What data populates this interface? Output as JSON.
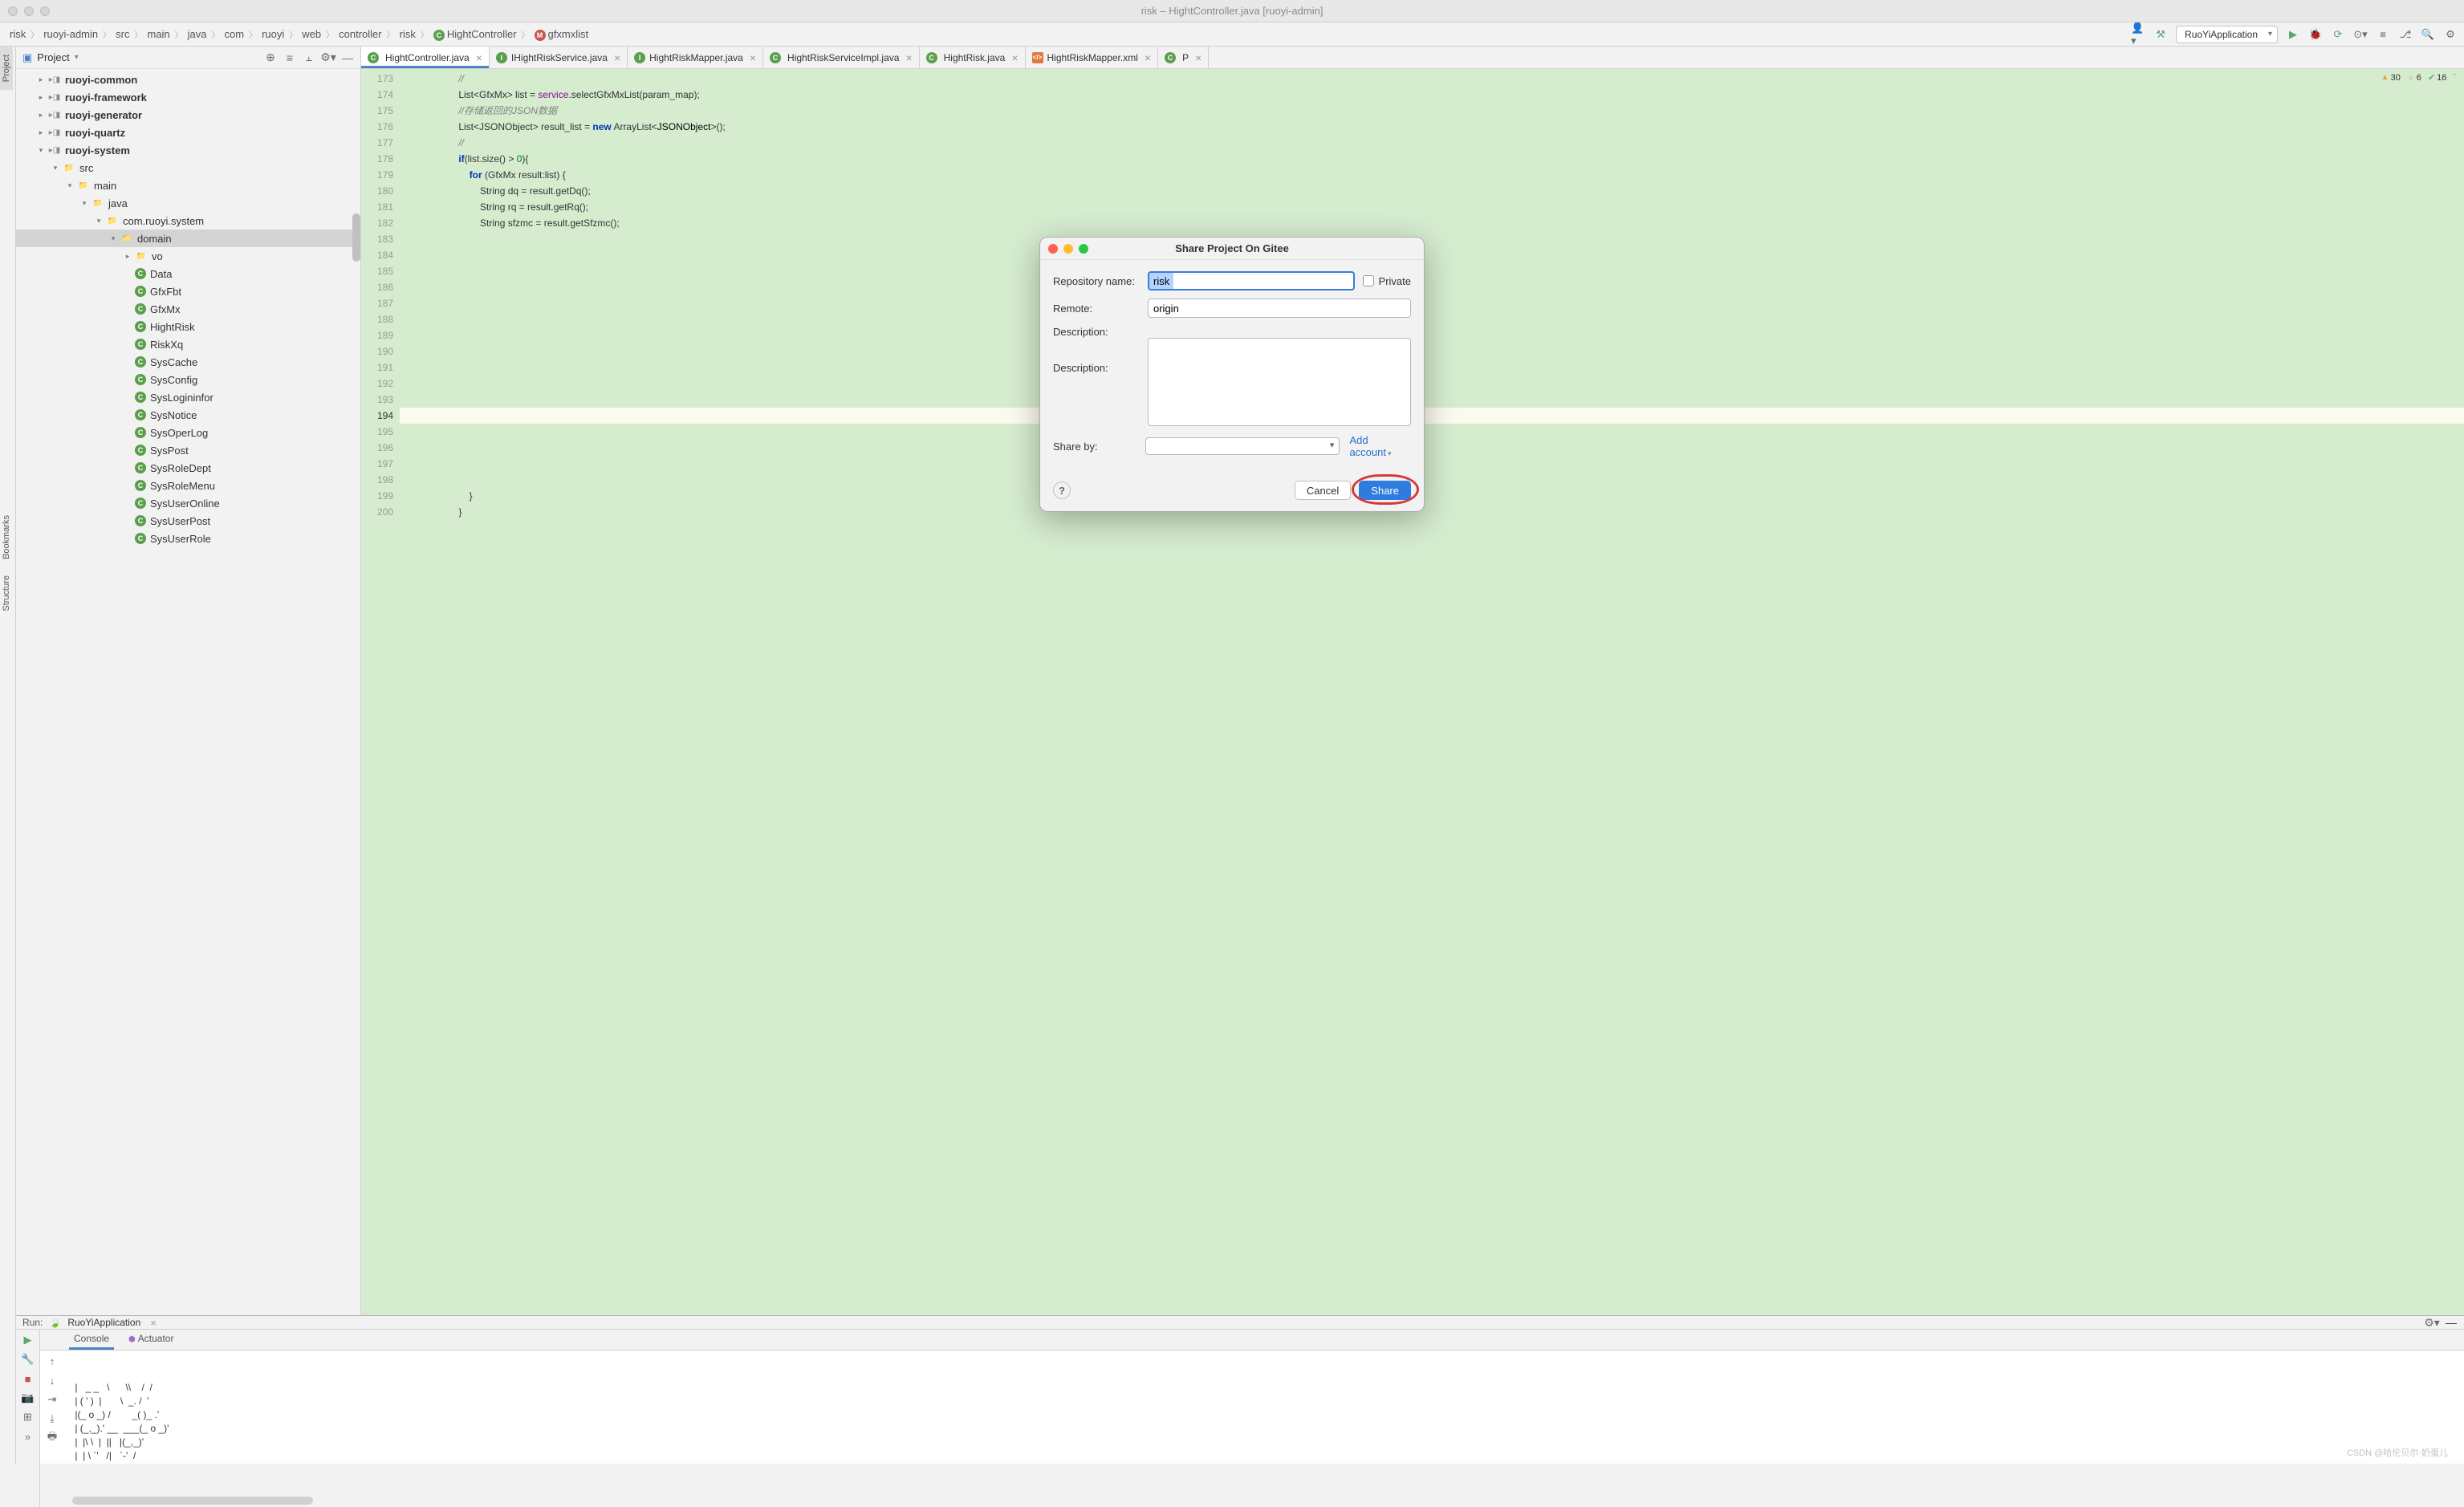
{
  "window": {
    "title": "risk – HightController.java [ruoyi-admin]"
  },
  "breadcrumbs": [
    {
      "label": "risk"
    },
    {
      "label": "ruoyi-admin"
    },
    {
      "label": "src"
    },
    {
      "label": "main"
    },
    {
      "label": "java"
    },
    {
      "label": "com"
    },
    {
      "label": "ruoyi"
    },
    {
      "label": "web"
    },
    {
      "label": "controller"
    },
    {
      "label": "risk"
    },
    {
      "label": "HightController",
      "icon": "c"
    },
    {
      "label": "gfxmxlist",
      "icon": "m"
    }
  ],
  "runConfig": "RuoYiApplication",
  "sidebar": {
    "title": "Project",
    "tree": [
      {
        "depth": 1,
        "arrow": "▸",
        "type": "module",
        "label": "ruoyi-common",
        "bold": true
      },
      {
        "depth": 1,
        "arrow": "▸",
        "type": "module",
        "label": "ruoyi-framework",
        "bold": true
      },
      {
        "depth": 1,
        "arrow": "▸",
        "type": "module",
        "label": "ruoyi-generator",
        "bold": true
      },
      {
        "depth": 1,
        "arrow": "▸",
        "type": "module",
        "label": "ruoyi-quartz",
        "bold": true
      },
      {
        "depth": 1,
        "arrow": "▾",
        "type": "module",
        "label": "ruoyi-system",
        "bold": true
      },
      {
        "depth": 2,
        "arrow": "▾",
        "type": "folder",
        "label": "src"
      },
      {
        "depth": 3,
        "arrow": "▾",
        "type": "folder",
        "label": "main"
      },
      {
        "depth": 4,
        "arrow": "▾",
        "type": "java-folder",
        "label": "java"
      },
      {
        "depth": 5,
        "arrow": "▾",
        "type": "pkg",
        "label": "com.ruoyi.system"
      },
      {
        "depth": 6,
        "arrow": "▾",
        "type": "pkg",
        "label": "domain",
        "selected": true
      },
      {
        "depth": 7,
        "arrow": "▸",
        "type": "pkg",
        "label": "vo"
      },
      {
        "depth": 7,
        "arrow": "",
        "type": "class",
        "label": "Data"
      },
      {
        "depth": 7,
        "arrow": "",
        "type": "class",
        "label": "GfxFbt"
      },
      {
        "depth": 7,
        "arrow": "",
        "type": "class",
        "label": "GfxMx"
      },
      {
        "depth": 7,
        "arrow": "",
        "type": "class",
        "label": "HightRisk"
      },
      {
        "depth": 7,
        "arrow": "",
        "type": "class",
        "label": "RiskXq"
      },
      {
        "depth": 7,
        "arrow": "",
        "type": "class",
        "label": "SysCache"
      },
      {
        "depth": 7,
        "arrow": "",
        "type": "class",
        "label": "SysConfig"
      },
      {
        "depth": 7,
        "arrow": "",
        "type": "class",
        "label": "SysLogininfor"
      },
      {
        "depth": 7,
        "arrow": "",
        "type": "class",
        "label": "SysNotice"
      },
      {
        "depth": 7,
        "arrow": "",
        "type": "class",
        "label": "SysOperLog"
      },
      {
        "depth": 7,
        "arrow": "",
        "type": "class",
        "label": "SysPost"
      },
      {
        "depth": 7,
        "arrow": "",
        "type": "class",
        "label": "SysRoleDept"
      },
      {
        "depth": 7,
        "arrow": "",
        "type": "class",
        "label": "SysRoleMenu"
      },
      {
        "depth": 7,
        "arrow": "",
        "type": "class",
        "label": "SysUserOnline"
      },
      {
        "depth": 7,
        "arrow": "",
        "type": "class",
        "label": "SysUserPost"
      },
      {
        "depth": 7,
        "arrow": "",
        "type": "class",
        "label": "SysUserRole"
      }
    ]
  },
  "editorTabs": [
    {
      "label": "HightController.java",
      "icon": "c",
      "active": true
    },
    {
      "label": "IHightRiskService.java",
      "icon": "i"
    },
    {
      "label": "HightRiskMapper.java",
      "icon": "i"
    },
    {
      "label": "HightRiskServiceImpl.java",
      "icon": "c"
    },
    {
      "label": "HightRisk.java",
      "icon": "c"
    },
    {
      "label": "HightRiskMapper.xml",
      "icon": "x"
    },
    {
      "label": "P",
      "icon": "c"
    }
  ],
  "indicators": {
    "warn": "30",
    "weak": "6",
    "ok": "16"
  },
  "gutter": {
    "start": 173,
    "end": 200,
    "current": 194
  },
  "code": [
    {
      "n": 173,
      "html": "                <span class='cm'>//</span>"
    },
    {
      "n": 174,
      "html": "                List&lt;GfxMx&gt; list = <span class='pm'>service</span>.selectGfxMxList(param_map);"
    },
    {
      "n": 175,
      "html": "                <span class='cm'>//存储返回的JSON数据</span>"
    },
    {
      "n": 176,
      "html": "                List&lt;JSONObject&gt; result_list = <span class='new'>new</span> ArrayList&lt;<span class='ty'>JSONObject</span>&gt;();"
    },
    {
      "n": 177,
      "html": "                <span class='cm'>//</span>"
    },
    {
      "n": 178,
      "html": "                <span class='kw'>if</span>(list.size() &gt; <span class='st'>0</span>){"
    },
    {
      "n": 179,
      "html": "                    <span class='kw'>for</span> (GfxMx result:list) {"
    },
    {
      "n": 180,
      "html": "                        String dq = result.getDq();"
    },
    {
      "n": 181,
      "html": "                        String rq = result.getRq();"
    },
    {
      "n": 182,
      "html": "                        String sfzmc = result.getSfzmc();"
    },
    {
      "n": 183,
      "html": " "
    },
    {
      "n": 184,
      "html": " "
    },
    {
      "n": 185,
      "html": " "
    },
    {
      "n": 186,
      "html": " "
    },
    {
      "n": 187,
      "html": " "
    },
    {
      "n": 188,
      "html": " "
    },
    {
      "n": 189,
      "html": " "
    },
    {
      "n": 190,
      "html": " "
    },
    {
      "n": 191,
      "html": " "
    },
    {
      "n": 192,
      "html": " "
    },
    {
      "n": 193,
      "html": " "
    },
    {
      "n": 194,
      "html": " ",
      "current": true
    },
    {
      "n": 195,
      "html": " "
    },
    {
      "n": 196,
      "html": " "
    },
    {
      "n": 197,
      "html": " "
    },
    {
      "n": 198,
      "html": " "
    },
    {
      "n": 199,
      "html": "                    }"
    },
    {
      "n": 200,
      "html": "                }"
    }
  ],
  "run": {
    "label": "Run:",
    "app": "RuoYiApplication",
    "tabs": [
      {
        "label": "Console",
        "active": true
      },
      {
        "label": "Actuator",
        "icon": true
      }
    ],
    "console": " |   _ _   \\      \\\\    /  /\n | ( ' )  |       \\  _. /  '\n |(_ o _) /        _( )_ .'\n | (_,_).' __  ___(_ o _)'\n |  |\\ \\  |  ||   |(_,_)'\n |  | \\ `'   /|   `-'  /"
  },
  "modal": {
    "title": "Share Project On Gitee",
    "repoLabel": "Repository name:",
    "repoValue": "risk",
    "privateLabel": "Private",
    "remoteLabel": "Remote:",
    "remoteValue": "origin",
    "descLabel": "Description:",
    "descLabel2": "Description:",
    "shareByLabel": "Share by:",
    "addAccount": "Add account",
    "cancel": "Cancel",
    "share": "Share"
  },
  "gutterTabs": [
    "Project",
    "Bookmarks",
    "Structure"
  ],
  "watermark": "CSDN @哈伦贝尔·奶蛋儿"
}
